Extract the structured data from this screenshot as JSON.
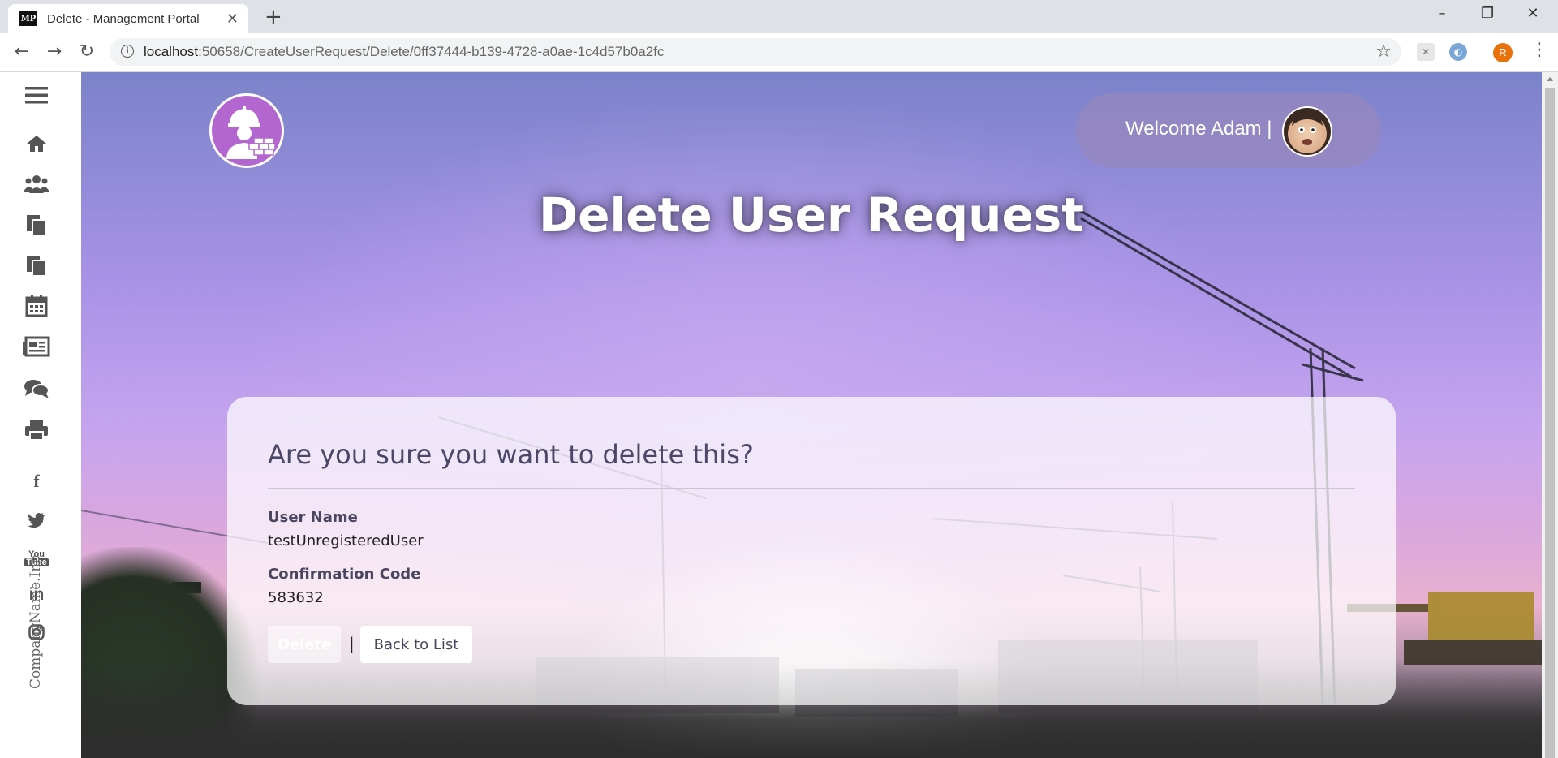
{
  "browser": {
    "tab_title": "Delete - Management Portal",
    "tab_favicon_text": "MP",
    "url_host": "localhost",
    "url_rest": ":50658/CreateUserRequest/Delete/0ff37444-b139-4728-a0ae-1c4d57b0a2fc",
    "profile_initial": "R",
    "window_controls": [
      "–",
      "❐",
      "✕"
    ]
  },
  "sidebar": {
    "items": [
      {
        "icon": "menu-icon"
      },
      {
        "icon": "home-icon"
      },
      {
        "icon": "users-icon"
      },
      {
        "icon": "documents-icon"
      },
      {
        "icon": "documents-icon"
      },
      {
        "icon": "calendar-icon"
      },
      {
        "icon": "newspaper-icon"
      },
      {
        "icon": "chat-icon"
      },
      {
        "icon": "print-icon"
      },
      {
        "icon": "facebook-icon"
      },
      {
        "icon": "twitter-icon"
      },
      {
        "icon": "youtube-icon"
      },
      {
        "icon": "linkedin-icon"
      },
      {
        "icon": "instagram-icon"
      }
    ],
    "company_text": "CompanyName.Inc"
  },
  "header": {
    "welcome_text": "Welcome Adam |"
  },
  "page": {
    "title": "Delete User Request",
    "question": "Are you sure you want to delete this?",
    "fields": [
      {
        "label": "User Name",
        "value": "testUnregisteredUser"
      },
      {
        "label": "Confirmation Code",
        "value": "583632"
      }
    ],
    "delete_label": "Delete",
    "separator": "|",
    "back_label": "Back to List"
  },
  "colors": {
    "logo_bg": "#b366cf",
    "profile_bg": "#e8710a"
  }
}
